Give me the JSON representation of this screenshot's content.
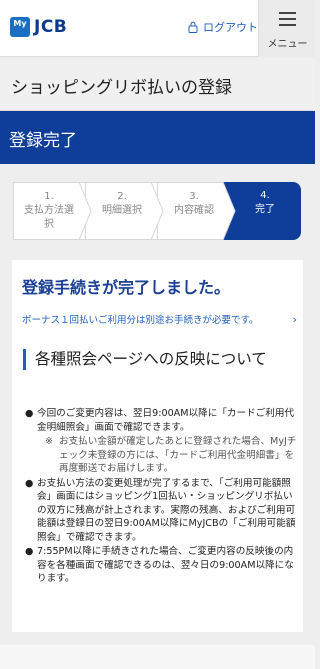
{
  "header": {
    "logo_my": "My",
    "logo_brand": "JCB",
    "logout_label": "ログアウト",
    "menu_label": "メニュー"
  },
  "page_title": "ショッピングリボ払いの登録",
  "status_title": "登録完了",
  "steps": [
    {
      "number": "1.",
      "label": "支払方法選\n択"
    },
    {
      "number": "2.",
      "label": "明細選択"
    },
    {
      "number": "3.",
      "label": "内容確認"
    },
    {
      "number": "4.",
      "label": "完了"
    }
  ],
  "card": {
    "done_title": "登録手続きが完了しました。",
    "bonus_link": "ボーナス１回払いご利用分は別途お手続きが必要です。",
    "section_heading": "各種照会ページへの反映について",
    "notes": [
      "今回のご変更内容は、翌日9:00AM以降に「カードご利用代金明細照会」画面で確認できます。",
      "お支払い方法の変更処理が完了するまで、「ご利用可能額照会」画面にはショッピング1回払い・ショッピングリボ払いの双方に残高が計上されます。実際の残高、およびご利用可能額は登録日の翌日9:00AM以降にMyJCBの「ご利用可能額照会」で確認できます。",
      "7:55PM以降に手続きされた場合、ご変更内容の反映後の内容を各種画面で確認できるのは、翌々日の9:00AM以降になります。"
    ],
    "subnote_mark": "※",
    "subnote": "お支払い金額が確定したあとに登録された場合、MyJチェック未登録の方には、「カードご利用代金明細書」を再度郵送でお届けします。",
    "bullet": "●"
  },
  "colors": {
    "brand_navy": "#0f3d9a",
    "link_blue": "#1f5fbf",
    "page_bg": "#eeeeee"
  },
  "icons": {
    "logout": "lock-icon",
    "menu": "hamburger-icon",
    "link_arrow": "chevron-right-icon"
  }
}
